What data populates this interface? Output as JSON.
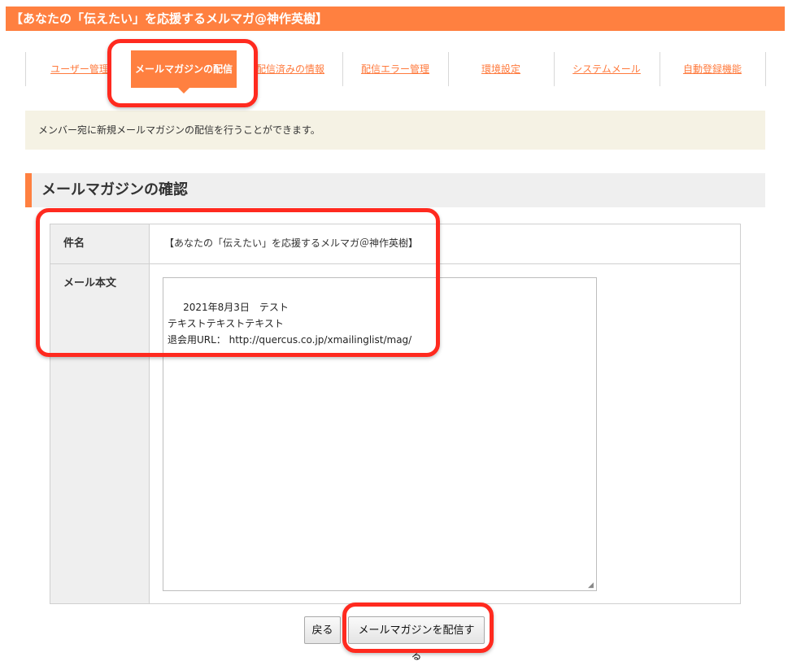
{
  "header": {
    "title": "【あなたの「伝えたい」を応援するメルマガ@神作英樹】"
  },
  "nav": {
    "tabs": [
      {
        "label": "ユーザー管理",
        "active": false
      },
      {
        "label": "メールマガジンの配信",
        "active": true
      },
      {
        "label": "配信済みの情報",
        "active": false
      },
      {
        "label": "配信エラー管理",
        "active": false
      },
      {
        "label": "環境設定",
        "active": false
      },
      {
        "label": "システムメール",
        "active": false
      },
      {
        "label": "自動登録機能",
        "active": false
      }
    ]
  },
  "info": {
    "text": "メンバー宛に新規メールマガジンの配信を行うことができます。"
  },
  "section": {
    "title": "メールマガジンの確認"
  },
  "form": {
    "subject_label": "件名",
    "subject_value": "【あなたの「伝えたい」を応援するメルマガ＠神作英樹】",
    "body_label": "メール本文",
    "body_value": " 2021年8月3日　テスト\nテキストテキストテキスト\n退会用URL： http://quercus.co.jp/xmailinglist/mag/"
  },
  "buttons": {
    "back_label": "戻る",
    "send_label": "メールマガジンを配信する"
  },
  "colors": {
    "accent": "#ff8040",
    "highlight": "#ff2a1f"
  }
}
